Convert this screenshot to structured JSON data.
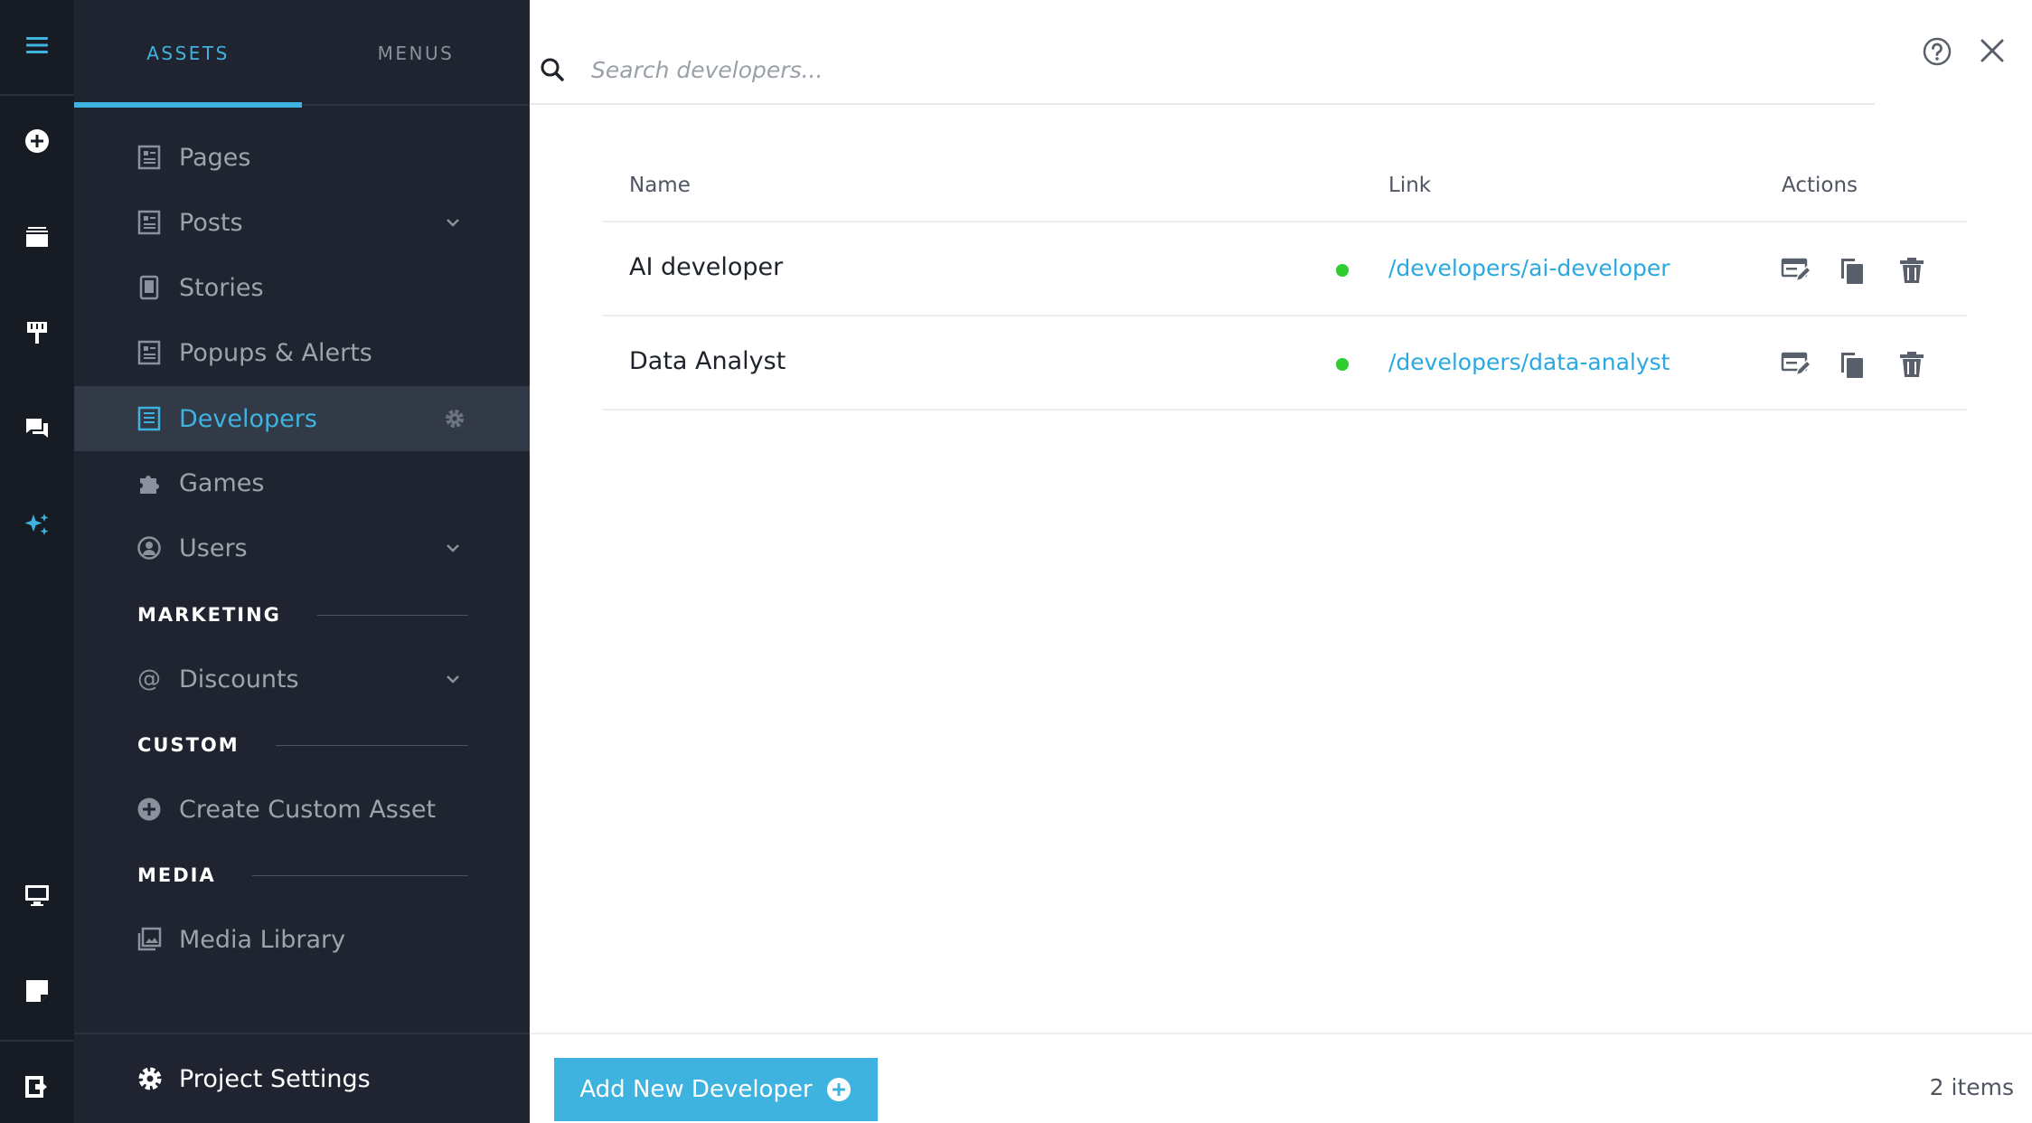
{
  "rail": {
    "items": [
      {
        "icon": "menu-icon"
      },
      {
        "icon": "add-circle-icon"
      },
      {
        "icon": "layers-icon"
      },
      {
        "icon": "paint-roller-icon"
      },
      {
        "icon": "chat-icon"
      },
      {
        "icon": "sparkle-icon"
      },
      {
        "icon": "monitor-icon"
      },
      {
        "icon": "sticky-note-icon"
      },
      {
        "icon": "logout-icon"
      }
    ],
    "accent": "#3fb3e0"
  },
  "sidebar": {
    "tabs": [
      {
        "label": "ASSETS",
        "active": true
      },
      {
        "label": "MENUS",
        "active": false
      }
    ],
    "items": [
      {
        "label": "Pages",
        "icon": "document-icon",
        "expandable": false
      },
      {
        "label": "Posts",
        "icon": "document-icon",
        "expandable": true
      },
      {
        "label": "Stories",
        "icon": "phone-document-icon",
        "expandable": false
      },
      {
        "label": "Popups & Alerts",
        "icon": "document-icon",
        "expandable": false
      },
      {
        "label": "Developers",
        "icon": "document-icon",
        "active": true,
        "has_settings": true
      },
      {
        "label": "Games",
        "icon": "puzzle-icon",
        "expandable": false
      },
      {
        "label": "Users",
        "icon": "user-circle-icon",
        "expandable": true
      }
    ],
    "sections": {
      "marketing": {
        "title": "MARKETING",
        "items": [
          {
            "label": "Discounts",
            "icon": "at-icon",
            "expandable": true
          }
        ]
      },
      "custom": {
        "title": "CUSTOM",
        "items": [
          {
            "label": "Create Custom Asset",
            "icon": "add-circle-icon"
          }
        ]
      },
      "media": {
        "title": "MEDIA",
        "items": [
          {
            "label": "Media Library",
            "icon": "images-icon"
          }
        ]
      }
    },
    "project_settings": {
      "label": "Project Settings",
      "icon": "gear-icon"
    }
  },
  "main": {
    "search": {
      "placeholder": "Search developers..."
    },
    "table": {
      "columns": {
        "name": "Name",
        "link": "Link",
        "actions": "Actions"
      },
      "rows": [
        {
          "name": "AI developer",
          "status": "published",
          "link": "/developers/ai-developer"
        },
        {
          "name": "Data Analyst",
          "status": "published",
          "link": "/developers/data-analyst"
        }
      ]
    },
    "footer": {
      "add_button": "Add New Developer",
      "count": "2 items"
    }
  },
  "colors": {
    "accent": "#3fb3e0",
    "status_green": "#2ecc2e",
    "sidebar_bg": "#1f2430",
    "rail_bg": "#161b24"
  }
}
